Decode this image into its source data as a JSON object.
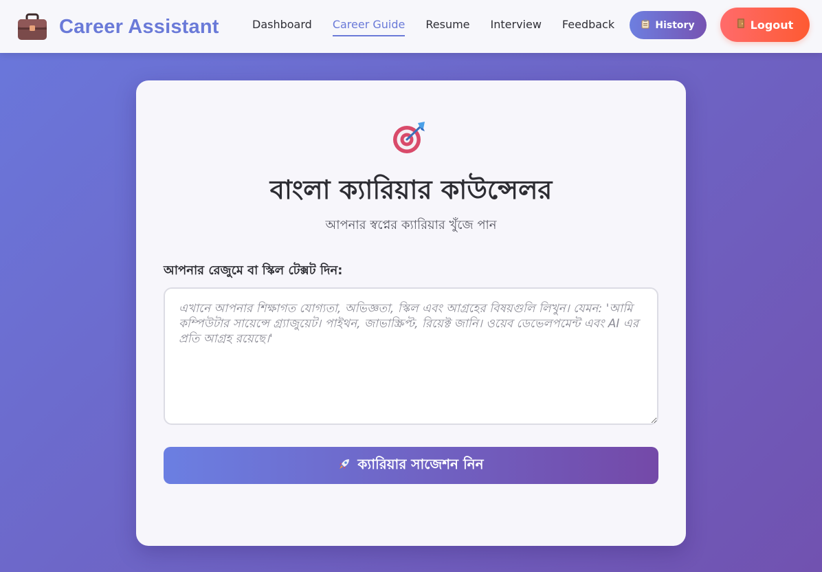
{
  "brand": {
    "title": "Career Assistant",
    "icon": "briefcase-icon"
  },
  "nav": {
    "links": [
      "Dashboard",
      "Career Guide",
      "Resume",
      "Interview",
      "Feedback"
    ],
    "active": "Career Guide"
  },
  "actions": {
    "history_label": "History",
    "history_icon": "clipboard-icon",
    "logout_label": "Logout",
    "logout_icon": "door-icon"
  },
  "card": {
    "icon": "target-icon",
    "title": "বাংলা ক্যারিয়ার কাউন্সেলর",
    "subtitle": "আপনার স্বপ্নের ক্যারিয়ার খুঁজে পান",
    "input_label": "আপনার রেজুমে বা স্কিল টেক্সট দিন:",
    "input_placeholder": "এখানে আপনার শিক্ষাগত যোগ্যতা, অভিজ্ঞতা, স্কিল এবং আগ্রহের বিষয়গুলি লিখুন। যেমন: 'আমি কম্পিউটার সায়েন্সে গ্র্যাজুয়েট। পাইথন, জাভাস্ক্রিপ্ট, রিয়েক্ট জানি। ওয়েব ডেভেলপমেন্ট এবং AI এর প্রতি আগ্রহ রয়েছে।'",
    "input_value": "",
    "submit_label": "ক্যারিয়ার সাজেশন নিন",
    "submit_icon": "rocket-icon"
  },
  "colors": {
    "accent": "#6a7ad8",
    "gradient_start": "#6a78dc",
    "gradient_end": "#7152b0",
    "logout": "#fe5a32"
  }
}
